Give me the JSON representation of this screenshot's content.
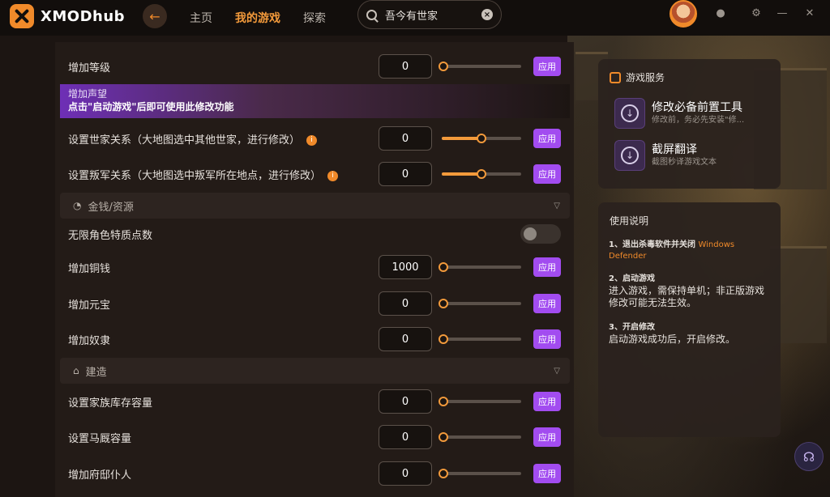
{
  "app": {
    "name": "XMODhub"
  },
  "nav": {
    "home": "主页",
    "my_games": "我的游戏",
    "explore": "探索"
  },
  "search": {
    "value": "吾今有世家"
  },
  "notice": {
    "title": "增加声望",
    "message": "点击\"启动游戏\"后即可使用此修改功能"
  },
  "rows_top": [
    {
      "label": "增加等级",
      "value": "0",
      "slider": 0,
      "apply": "应用"
    },
    {
      "label": "设置世家关系（大地图选中其他世家，进行修改）",
      "value": "0",
      "slider": 0.5,
      "apply": "应用",
      "info": "i"
    },
    {
      "label": "设置叛军关系（大地图选中叛军所在地点，进行修改）",
      "value": "0",
      "slider": 0.5,
      "apply": "应用",
      "info": "i"
    }
  ],
  "section_money": {
    "label": "金钱/资源"
  },
  "toggle_row": {
    "label": "无限角色特质点数",
    "on": false
  },
  "rows_money": [
    {
      "label": "增加铜钱",
      "value": "1000",
      "slider": 0,
      "apply": "应用"
    },
    {
      "label": "增加元宝",
      "value": "0",
      "slider": 0,
      "apply": "应用"
    },
    {
      "label": "增加奴隶",
      "value": "0",
      "slider": 0,
      "apply": "应用"
    }
  ],
  "section_build": {
    "label": "建造"
  },
  "rows_build": [
    {
      "label": "设置家族库存容量",
      "value": "0",
      "slider": 0,
      "apply": "应用"
    },
    {
      "label": "设置马厩容量",
      "value": "0",
      "slider": 0,
      "apply": "应用"
    },
    {
      "label": "增加府邸仆人",
      "value": "0",
      "slider": 0,
      "apply": "应用"
    }
  ],
  "services": {
    "title": "游戏服务",
    "tools": [
      {
        "name": "修改必备前置工具",
        "desc": "修改前，务必先安装\"修..."
      },
      {
        "name": "截屏翻译",
        "desc": "截图秒译游戏文本"
      }
    ]
  },
  "guide": {
    "title": "使用说明",
    "step1_head": "1、退出杀毒软件并关闭",
    "step1_orange": "Windows Defender",
    "step2_head": "2、启动游戏",
    "step2_body": "进入游戏，需保持单机；非正版游戏修改可能无法生效。",
    "step3_head": "3、开启修改",
    "step3_body": "启动游戏成功后，开启修改。"
  },
  "colors": {
    "accent": "#f08a2a",
    "apply": "#a24cf0",
    "background": "#1c1512"
  }
}
